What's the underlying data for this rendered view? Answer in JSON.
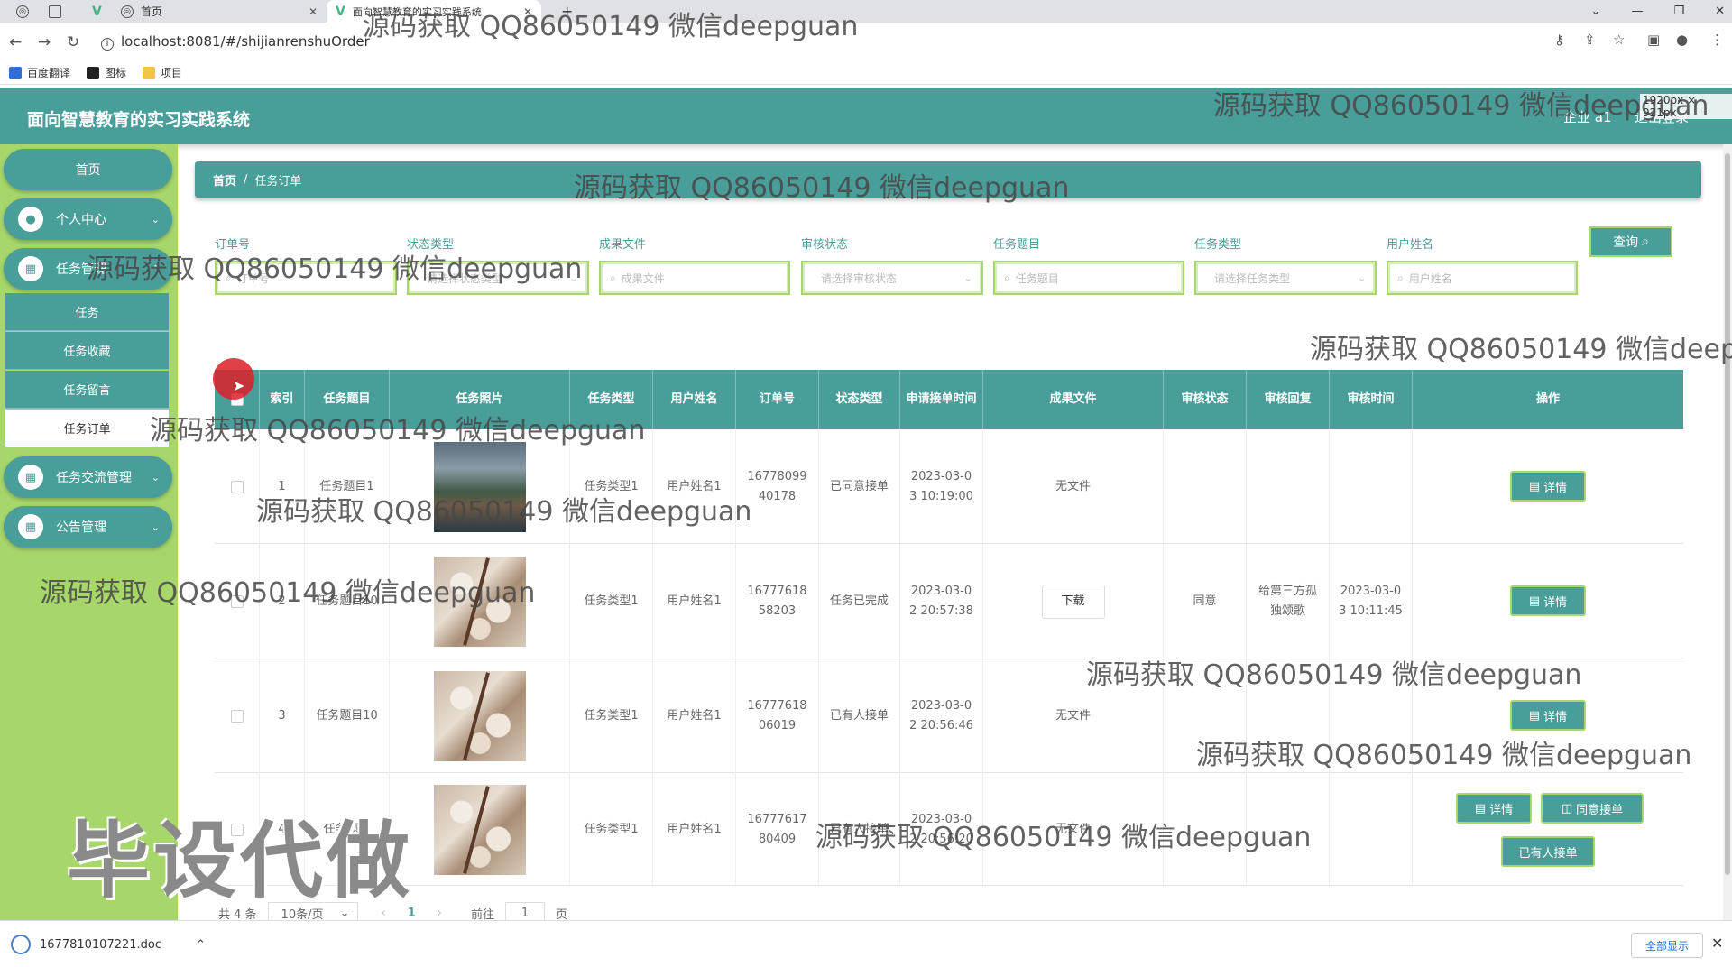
{
  "browser": {
    "tabs": [
      {
        "title": ""
      },
      {
        "title": ""
      },
      {
        "title": "首页"
      },
      {
        "title": "面向智慧教育的实习实践系统"
      }
    ],
    "url": "localhost:8081/#/shijianrenshuOrder",
    "bookmarks": [
      "百度翻译",
      "图标",
      "项目"
    ]
  },
  "app": {
    "title": "面向智慧教育的实习实践系统",
    "user": "企业 a1",
    "logout": "退出登录",
    "viewport_badge": "1920px × 921px"
  },
  "sidebar": {
    "home": "首页",
    "personal": "个人中心",
    "task_mgmt": "任务管理",
    "task_sub": [
      "任务",
      "任务收藏",
      "任务留言",
      "任务订单"
    ],
    "exchange": "任务交流管理",
    "notice": "公告管理"
  },
  "breadcrumb": {
    "home": "首页",
    "sep": "/",
    "current": "任务订单"
  },
  "filters": [
    {
      "label": "订单号",
      "placeholder": "订单号",
      "type": "input"
    },
    {
      "label": "状态类型",
      "placeholder": "请选择状态类型",
      "type": "select"
    },
    {
      "label": "成果文件",
      "placeholder": "成果文件",
      "type": "input"
    },
    {
      "label": "审核状态",
      "placeholder": "请选择审核状态",
      "type": "select"
    },
    {
      "label": "任务题目",
      "placeholder": "任务题目",
      "type": "input"
    },
    {
      "label": "任务类型",
      "placeholder": "请选择任务类型",
      "type": "select"
    },
    {
      "label": "用户姓名",
      "placeholder": "用户姓名",
      "type": "input"
    }
  ],
  "query_button": "查询",
  "table": {
    "headers": [
      "",
      "索引",
      "任务题目",
      "任务照片",
      "任务类型",
      "用户姓名",
      "订单号",
      "状态类型",
      "申请接单时间",
      "成果文件",
      "审核状态",
      "审核回复",
      "审核时间",
      "操作"
    ],
    "rows": [
      {
        "index": "1",
        "title": "任务题目1",
        "photo": "lake",
        "type": "任务类型1",
        "user": "用户姓名1",
        "order": "1677809940178",
        "status": "已同意接单",
        "time": "2023-03-03 10:19:00",
        "file": "无文件",
        "audit": "",
        "reply": "",
        "audit_time": ""
      },
      {
        "index": "2",
        "title": "任务题目10",
        "photo": "tree",
        "type": "任务类型1",
        "user": "用户姓名1",
        "order": "1677761858203",
        "status": "任务已完成",
        "time": "2023-03-02 20:57:38",
        "file": "下载",
        "audit": "同意",
        "reply": "给第三方孤独颂歌",
        "audit_time": "2023-03-03 10:11:45"
      },
      {
        "index": "3",
        "title": "任务题目10",
        "photo": "tree",
        "type": "任务类型1",
        "user": "用户姓名1",
        "order": "1677761806019",
        "status": "已有人接单",
        "time": "2023-03-02 20:56:46",
        "file": "无文件",
        "audit": "",
        "reply": "",
        "audit_time": ""
      },
      {
        "index": "4",
        "title": "任务题目",
        "photo": "tree",
        "type": "任务类型1",
        "user": "用户姓名1",
        "order": "1677761780409",
        "status": "已有人接单",
        "time": "2023-03-02 20:56:20",
        "file": "无文件",
        "audit": "",
        "reply": "",
        "audit_time": ""
      }
    ],
    "actions": {
      "detail": "详情",
      "agree": "同意接单",
      "taken": "已有人接单"
    }
  },
  "pagination": {
    "total": "共 4 条",
    "page_size": "10条/页",
    "current": "1",
    "goto": "前往",
    "goto_value": "1",
    "page_unit": "页"
  },
  "download_bar": {
    "file": "1677810107221.doc",
    "show_all": "全部显示"
  },
  "watermark": {
    "text": "源码获取 QQ86050149 微信deepguan",
    "big": "毕设代做"
  }
}
